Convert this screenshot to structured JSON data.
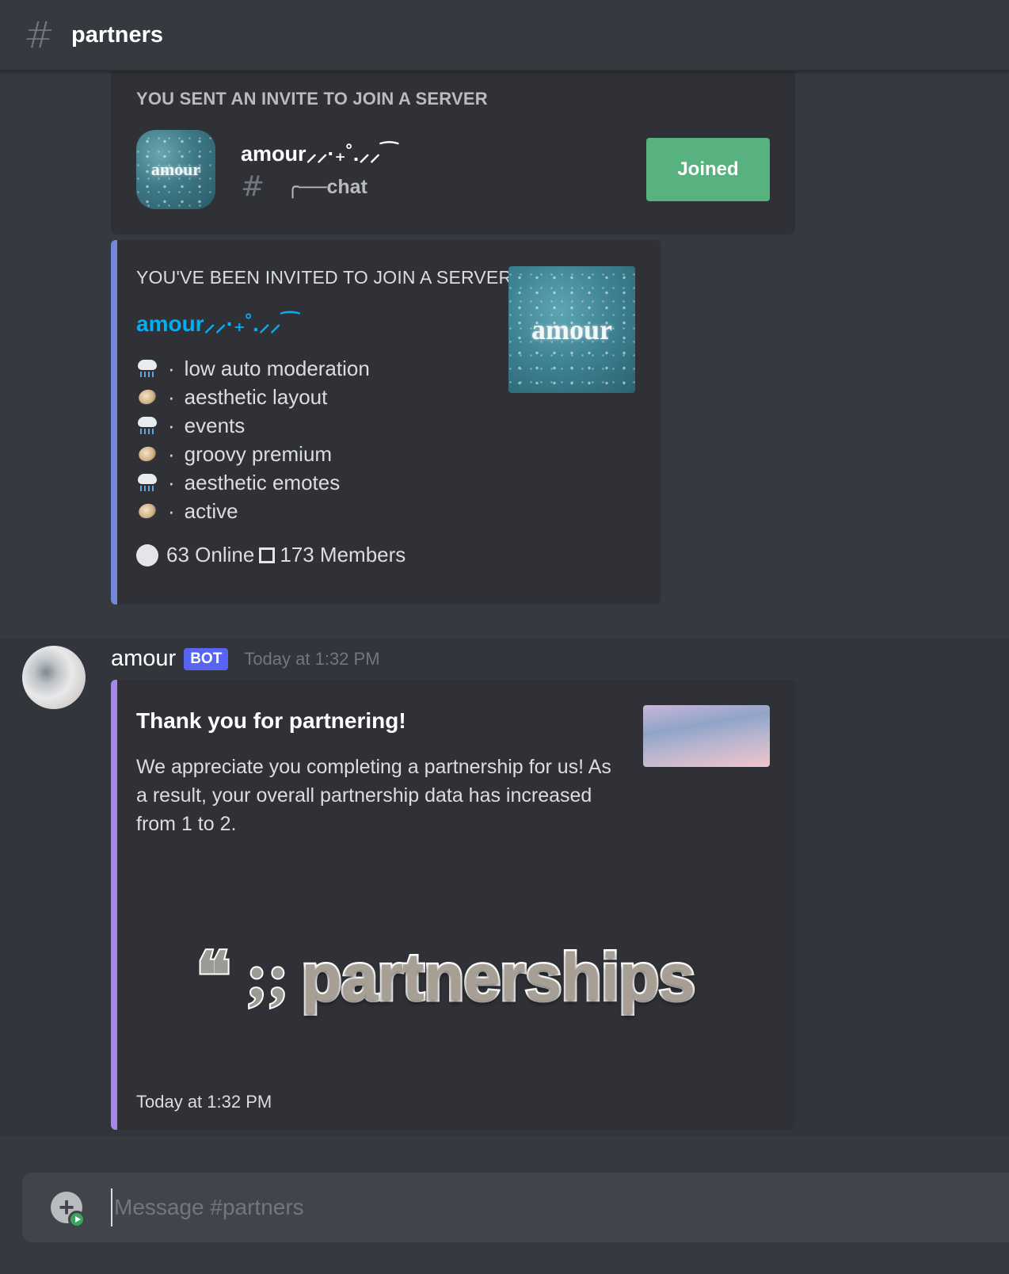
{
  "header": {
    "channel_icon": "hash-icon",
    "channel_name": "partners"
  },
  "sent_invite": {
    "heading": "YOU SENT AN INVITE TO JOIN A SERVER",
    "server_icon_text": "amour",
    "server_name": "amour⸝⸝·₊˚.⸝⸝⁀",
    "channel_icon": "hash-icon",
    "channel_name": "╭──chat",
    "button_label": "Joined",
    "button_color": "#57b27f"
  },
  "invite_embed": {
    "heading": "YOU'VE BEEN INVITED TO JOIN A SERVER",
    "server_name": "amour⸝⸝·₊˚.⸝⸝⁀",
    "thumbnail_text": "amour",
    "accent_color": "#7289da",
    "features": [
      {
        "icon": "cloud-rain-icon",
        "text": "low auto moderation"
      },
      {
        "icon": "pie-icon",
        "text": "aesthetic layout"
      },
      {
        "icon": "cloud-rain-icon",
        "text": "events"
      },
      {
        "icon": "pie-icon",
        "text": "groovy premium"
      },
      {
        "icon": "cloud-rain-icon",
        "text": "aesthetic emotes"
      },
      {
        "icon": "pie-icon",
        "text": "active"
      }
    ],
    "separator": "·",
    "online_count": "63 Online",
    "members_count": "173 Members"
  },
  "bot_message": {
    "author": "amour",
    "bot_tag": "BOT",
    "timestamp": "Today at 1:32 PM",
    "embed": {
      "accent_color": "#a687e6",
      "title": "Thank you for partnering!",
      "description": "We appreciate you completing a partnership for us! As a result, your overall partnership data has increased from 1 to 2.",
      "image_quote": "❝ ;;",
      "image_word": "partnerships",
      "footer": "Today at 1:32 PM"
    }
  },
  "composer": {
    "placeholder": "Message #partners",
    "attach_icon": "plus-circle-icon"
  }
}
